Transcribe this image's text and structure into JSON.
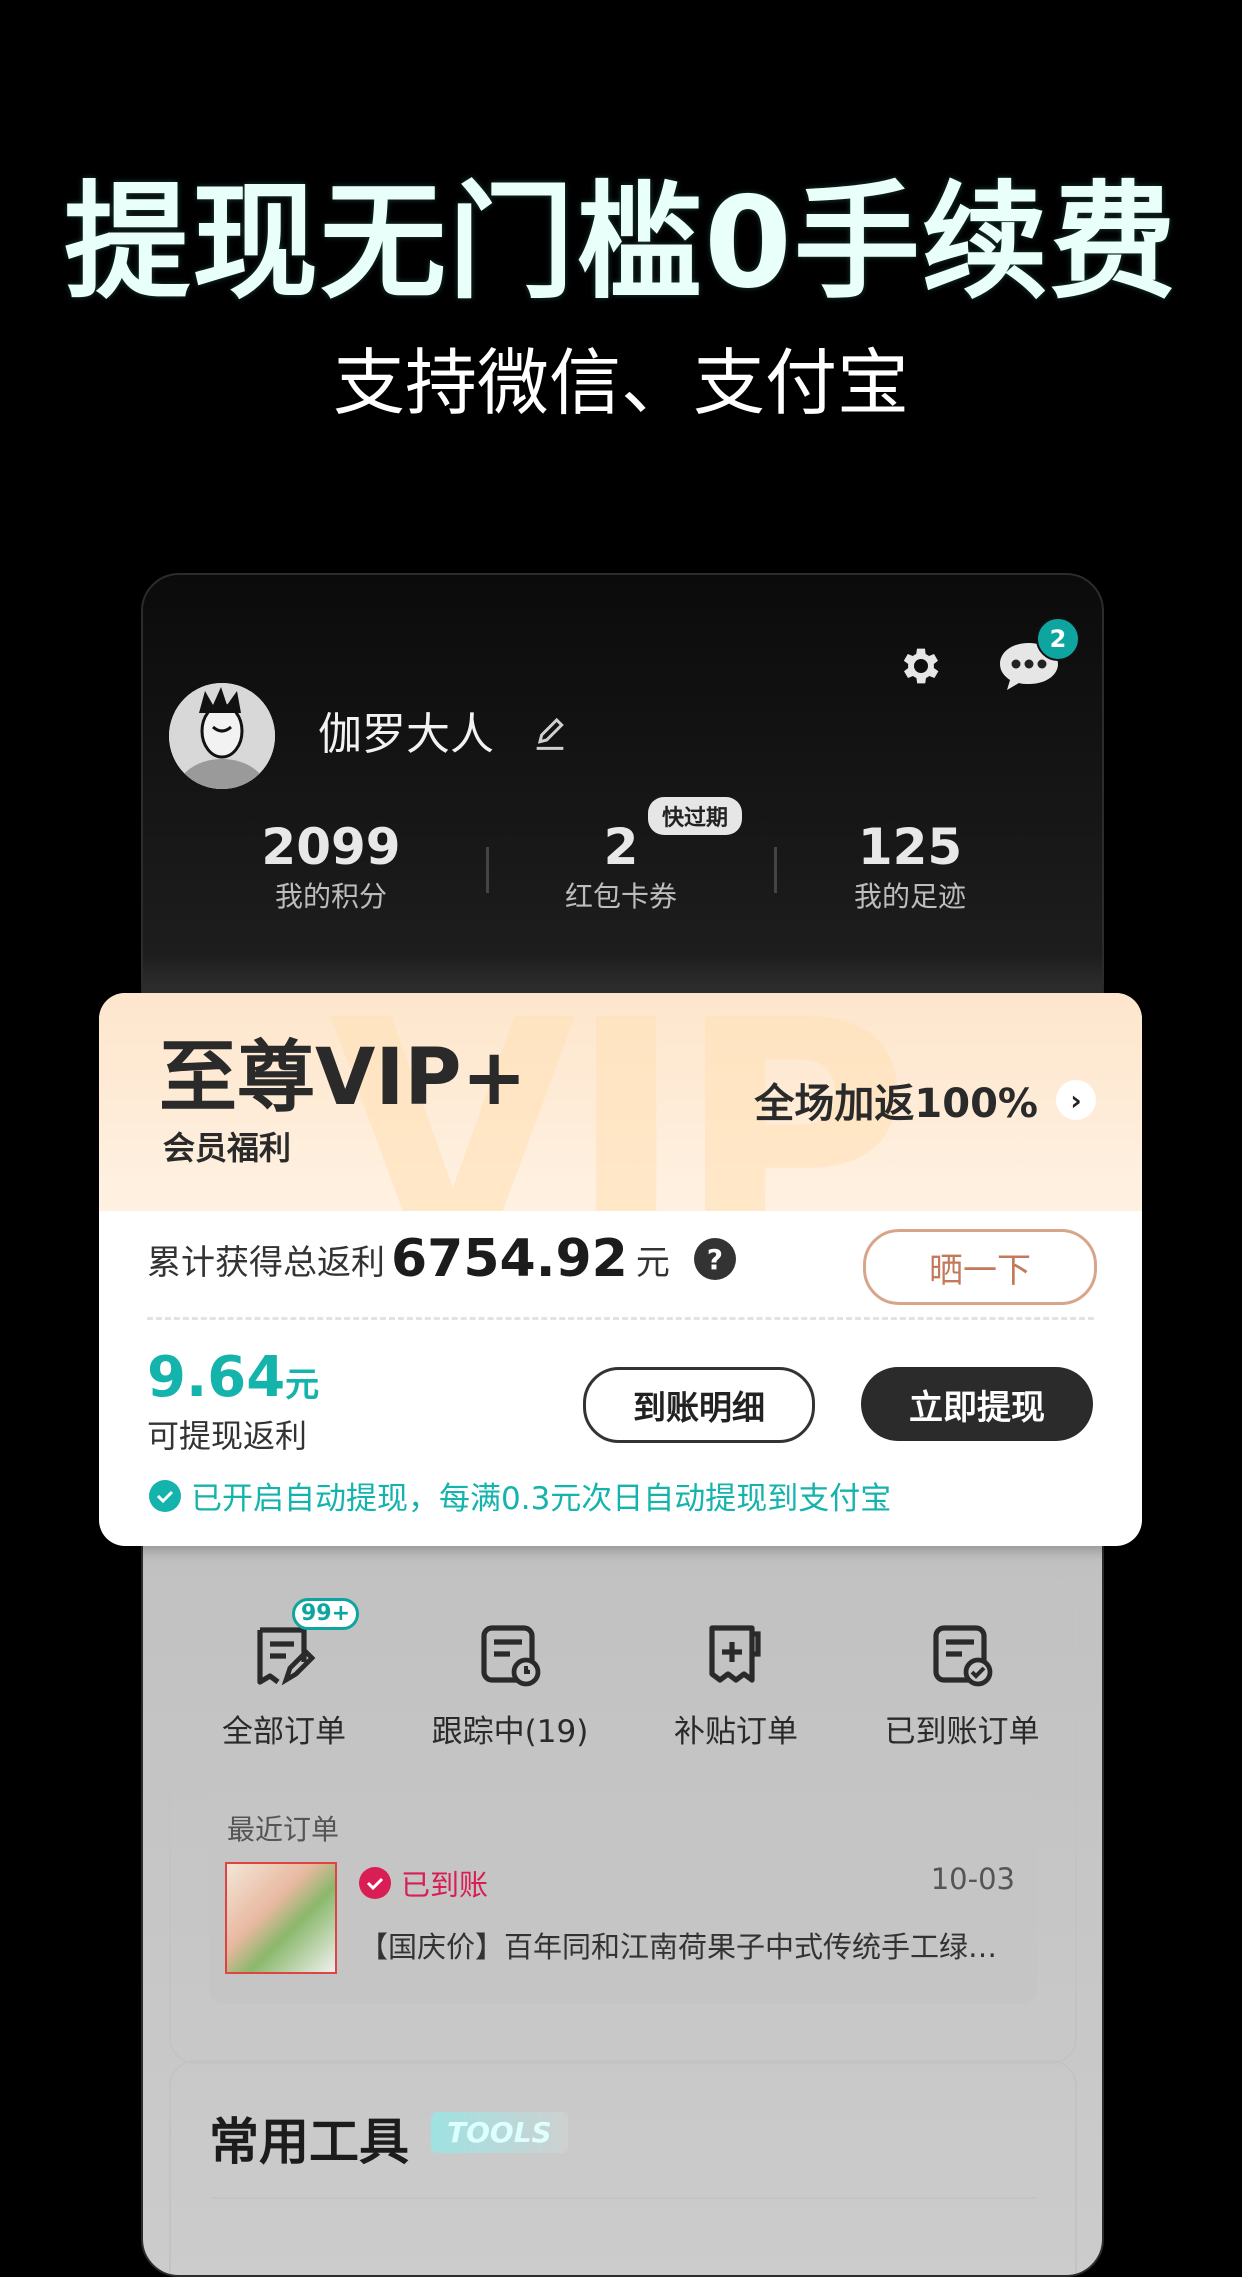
{
  "promo": {
    "title": "提现无门槛0手续费",
    "subtitle": "支持微信、支付宝"
  },
  "header": {
    "message_badge": "2"
  },
  "profile": {
    "name": "伽罗大人"
  },
  "stats": [
    {
      "value": "2099",
      "label": "我的积分"
    },
    {
      "value": "2",
      "label": "红包卡券",
      "tag": "快过期"
    },
    {
      "value": "125",
      "label": "我的足迹"
    }
  ],
  "vip": {
    "title": "至尊VIP+",
    "subtitle": "会员福利",
    "watermark": "VIP",
    "promo": "全场加返100%",
    "arrow": "›",
    "total_label": "累计获得总返利",
    "total_amount": "6754.92",
    "total_unit": "元",
    "help": "?",
    "share_button": "晒一下",
    "withdrawable_amount": "9.64",
    "withdrawable_unit": "元",
    "withdrawable_label": "可提现返利",
    "detail_button": "到账明细",
    "withdraw_button": "立即提现",
    "auto_notice": "已开启自动提现，每满0.3元次日自动提现到支付宝"
  },
  "orders": {
    "tabs": [
      {
        "label": "全部订单",
        "badge": "99+"
      },
      {
        "label": "跟踪中(19)"
      },
      {
        "label": "补贴订单"
      },
      {
        "label": "已到账订单"
      }
    ],
    "recent_title": "最近订单",
    "recent": {
      "status": "已到账",
      "date": "10-03",
      "name": "【国庆价】百年同和江南荷果子中式传统手工绿豆..."
    }
  },
  "tools": {
    "title": "常用工具",
    "tag": "TOOLS"
  },
  "colors": {
    "accent_teal": "#14b3ac",
    "status_red": "#d81e54",
    "vip_header": "#fde6cc"
  }
}
